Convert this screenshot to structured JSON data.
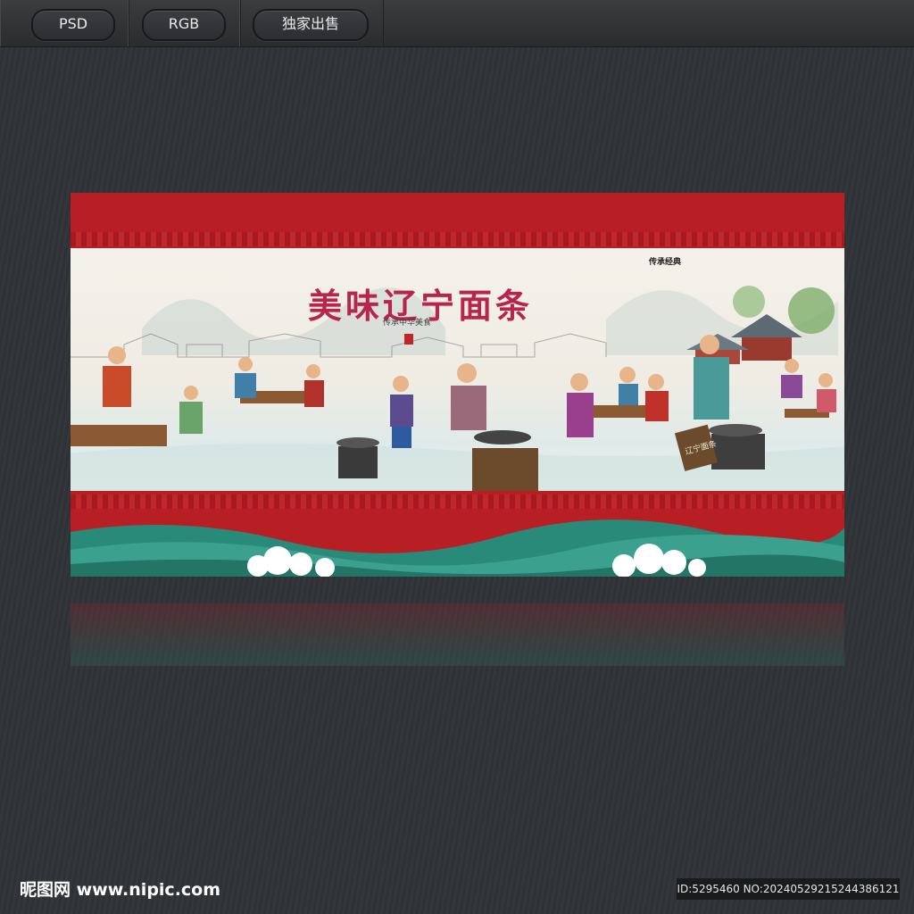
{
  "toolbar": {
    "badges": [
      "PSD",
      "RGB",
      "独家出售"
    ]
  },
  "artwork": {
    "title": "美味辽宁面条",
    "subtitle": "传承中华美食",
    "corner_text": "传承经典",
    "sign_text": "辽宁面条"
  },
  "footer": {
    "site": "昵图网 www.nipic.com",
    "id_text": "ID:5295460 NO:20240529215244386121"
  },
  "colors": {
    "background": "#303336",
    "banner_red": "#b81f24",
    "wave_green": "#2a8a7a",
    "cloud_white": "#ffffff"
  }
}
